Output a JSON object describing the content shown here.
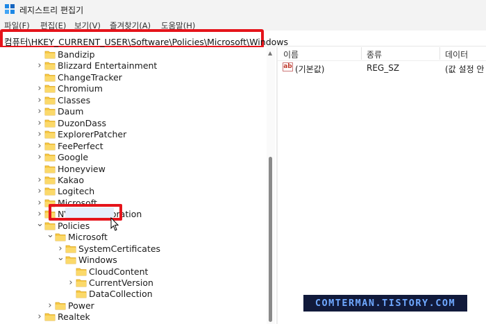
{
  "window": {
    "title": "레지스트리 편집기"
  },
  "menu": {
    "file": "파일(F)",
    "edit": "편집(E)",
    "view": "보기(V)",
    "favorites": "즐겨찾기(A)",
    "help": "도움말(H)"
  },
  "address": {
    "path": "컴퓨터\\HKEY_CURRENT_USER\\Software\\Policies\\Microsoft\\Windows"
  },
  "tree": {
    "items": [
      {
        "label": "Bandizip",
        "expandable": false,
        "expanded": false
      },
      {
        "label": "Blizzard Entertainment",
        "expandable": true,
        "expanded": false
      },
      {
        "label": "ChangeTracker",
        "expandable": false,
        "expanded": false
      },
      {
        "label": "Chromium",
        "expandable": true,
        "expanded": false
      },
      {
        "label": "Classes",
        "expandable": true,
        "expanded": false
      },
      {
        "label": "Daum",
        "expandable": true,
        "expanded": false
      },
      {
        "label": "DuzonDass",
        "expandable": true,
        "expanded": false
      },
      {
        "label": "ExplorerPatcher",
        "expandable": true,
        "expanded": false
      },
      {
        "label": "FeePerfect",
        "expandable": true,
        "expanded": false
      },
      {
        "label": "Google",
        "expandable": true,
        "expanded": false
      },
      {
        "label": "Honeyview",
        "expandable": false,
        "expanded": false
      },
      {
        "label": "Kakao",
        "expandable": true,
        "expanded": false
      },
      {
        "label": "Logitech",
        "expandable": true,
        "expanded": false
      },
      {
        "label": "Microsoft",
        "expandable": true,
        "expanded": false
      },
      {
        "label": "NVIDIA Corporation",
        "expandable": true,
        "expanded": false
      },
      {
        "label": "Policies",
        "expandable": true,
        "expanded": true
      },
      {
        "label": "Microsoft",
        "expandable": true,
        "expanded": true
      },
      {
        "label": "SystemCertificates",
        "expandable": true,
        "expanded": false
      },
      {
        "label": "Windows",
        "expandable": true,
        "expanded": true,
        "selected": true
      },
      {
        "label": "CloudContent",
        "expandable": false,
        "expanded": false
      },
      {
        "label": "CurrentVersion",
        "expandable": true,
        "expanded": false
      },
      {
        "label": "DataCollection",
        "expandable": false,
        "expanded": false
      },
      {
        "label": "Power",
        "expandable": true,
        "expanded": false
      },
      {
        "label": "Realtek",
        "expandable": true,
        "expanded": false
      }
    ]
  },
  "values": {
    "columns": [
      "이름",
      "종류",
      "데이터"
    ],
    "rows": [
      {
        "name": "(기본값)",
        "type": "REG_SZ",
        "data": "(값 설정 안"
      }
    ]
  },
  "watermark": {
    "text": "COMTERMAN.TISTORY.COM"
  },
  "colors": {
    "highlight_red": "#e5141b",
    "folder_yellow": "#f7c945",
    "watermark_bg": "#111a3b",
    "watermark_fg": "#6fa8ff",
    "selection": "#e5eefc"
  }
}
